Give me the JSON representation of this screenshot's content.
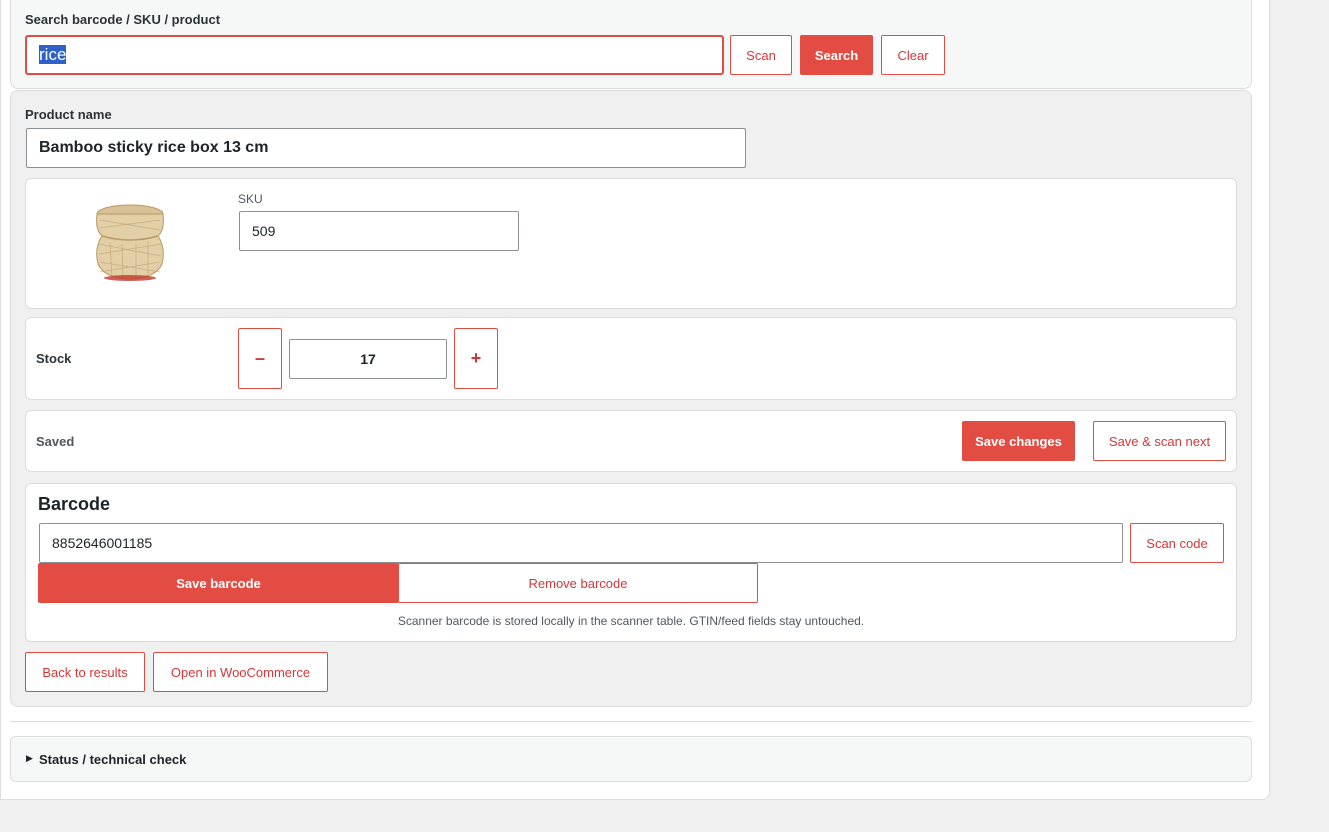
{
  "search": {
    "label": "Search barcode / SKU / product",
    "value": "rice",
    "scan_label": "Scan",
    "search_label": "Search",
    "clear_label": "Clear"
  },
  "product": {
    "name_label": "Product name",
    "name_value": "Bamboo sticky rice box 13 cm",
    "sku_label": "SKU",
    "sku_value": "509",
    "image_alt": "bamboo sticky rice basket"
  },
  "stock": {
    "label": "Stock",
    "minus_label": "–",
    "value": "17",
    "plus_label": "+"
  },
  "save": {
    "status": "Saved",
    "save_changes_label": "Save changes",
    "save_scan_next_label": "Save & scan next"
  },
  "barcode": {
    "heading": "Barcode",
    "value": "8852646001185",
    "scan_code_label": "Scan code",
    "save_label": "Save barcode",
    "remove_label": "Remove barcode",
    "note": "Scanner barcode is stored locally in the scanner table. GTIN/feed fields stay untouched."
  },
  "actions": {
    "back_label": "Back to results",
    "open_woo_label": "Open in WooCommerce"
  },
  "status_check": {
    "label": "Status / technical check"
  },
  "colors": {
    "accent": "#e34c42",
    "accent_text": "#d63638",
    "selection": "#2f62c8"
  }
}
